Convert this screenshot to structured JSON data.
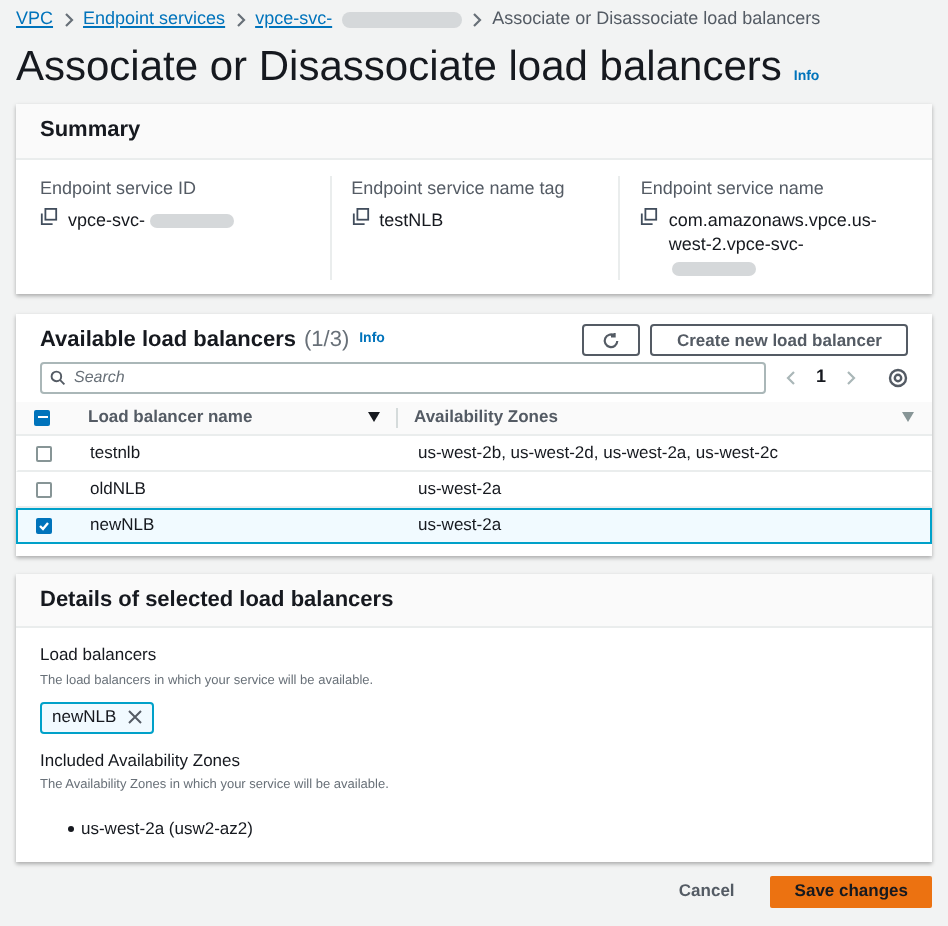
{
  "breadcrumbs": [
    {
      "label": "VPC",
      "link": true,
      "redacted": false
    },
    {
      "label": "Endpoint services",
      "link": true,
      "redacted": false
    },
    {
      "label": "vpce-svc-",
      "link": true,
      "redacted": true
    },
    {
      "label": "Associate or Disassociate load balancers",
      "link": false,
      "redacted": false
    }
  ],
  "page_title": "Associate or Disassociate load balancers",
  "page_info": "Info",
  "summary": {
    "title": "Summary",
    "fields": [
      {
        "label": "Endpoint service ID",
        "value": "vpce-svc-",
        "redacted": true
      },
      {
        "label": "Endpoint service name tag",
        "value": "testNLB",
        "redacted": false
      },
      {
        "label": "Endpoint service name",
        "value": "com.amazonaws.vpce.us-west-2.vpce-svc-",
        "redacted": true
      }
    ]
  },
  "available": {
    "title": "Available load balancers",
    "count": "(1/3)",
    "info": "Info",
    "create_button": "Create new load balancer",
    "select_all_indeterminate": true,
    "search": {
      "placeholder": "Search"
    },
    "page": "1",
    "columns": [
      "Load balancer name",
      "Availability Zones"
    ],
    "rows": [
      {
        "name": "testnlb",
        "zones": "us-west-2b, us-west-2d, us-west-2a, us-west-2c",
        "selected": false
      },
      {
        "name": "oldNLB",
        "zones": "us-west-2a",
        "selected": false
      },
      {
        "name": "newNLB",
        "zones": "us-west-2a",
        "selected": true
      }
    ]
  },
  "details": {
    "title": "Details of selected load balancers",
    "lb_label": "Load balancers",
    "lb_description": "The load balancers in which your service will be available.",
    "tokens": [
      "newNLB"
    ],
    "az_label": "Included Availability Zones",
    "az_description": "The Availability Zones in which your service will be available.",
    "zones": [
      "us-west-2a (usw2-az2)"
    ]
  },
  "actions": {
    "cancel": "Cancel",
    "save": "Save changes"
  }
}
